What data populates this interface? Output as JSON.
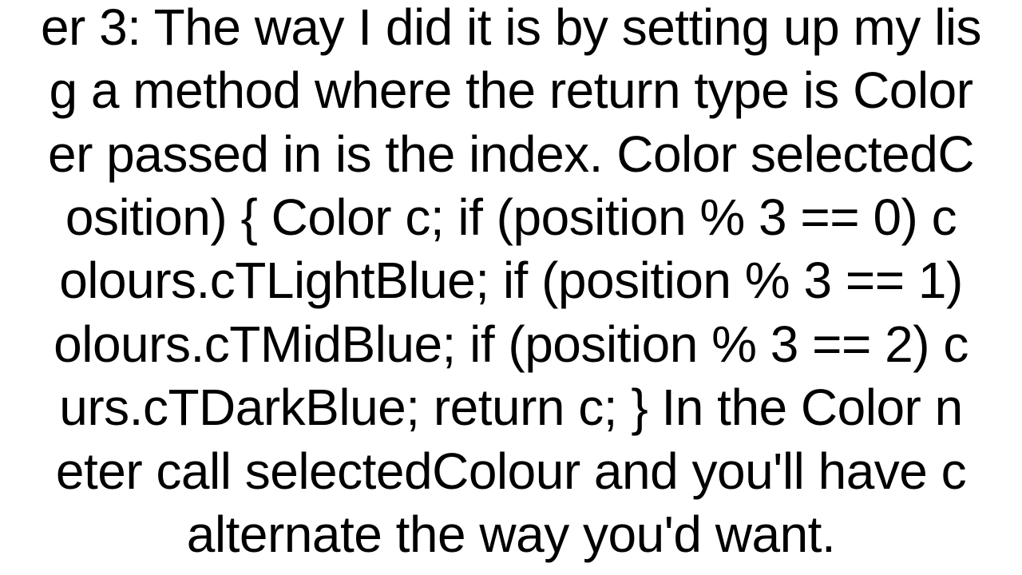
{
  "paragraph": {
    "line1": "er 3: The way I did it is by setting up my lis",
    "line2": "g a method where the return type is Color ",
    "line3": "er passed in is the index. Color selectedC",
    "line4": "osition) {   Color c;   if (position % 3 == 0) c",
    "line5": "olours.cTLightBlue;   if (position % 3 == 1) ",
    "line6": "olours.cTMidBlue;   if (position % 3 == 2) c",
    "line7": "urs.cTDarkBlue;   return c; }  In the Color n",
    "line8": "eter call selectedColour and you'll have c",
    "line9": "alternate the way you'd want."
  }
}
